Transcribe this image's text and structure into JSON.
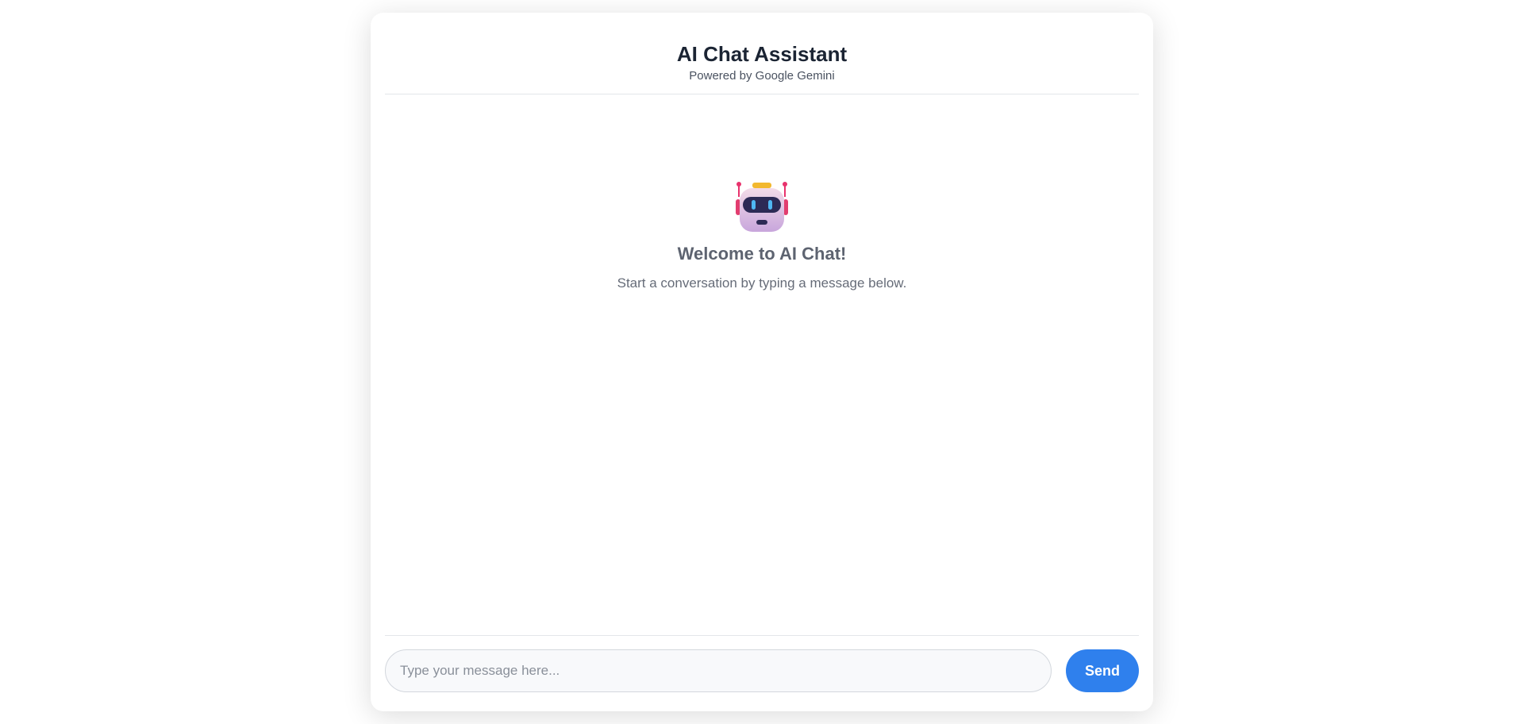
{
  "header": {
    "title": "AI Chat Assistant",
    "subtitle": "Powered by Google Gemini"
  },
  "welcome": {
    "icon": "robot-icon",
    "title": "Welcome to AI Chat!",
    "text": "Start a conversation by typing a message below."
  },
  "composer": {
    "input_value": "",
    "placeholder": "Type your message here...",
    "send_label": "Send"
  },
  "colors": {
    "accent": "#2f80ed",
    "title": "#1b2433",
    "muted": "#666c78",
    "border": "#e3e6ea",
    "input_bg": "#f8f9fb"
  }
}
